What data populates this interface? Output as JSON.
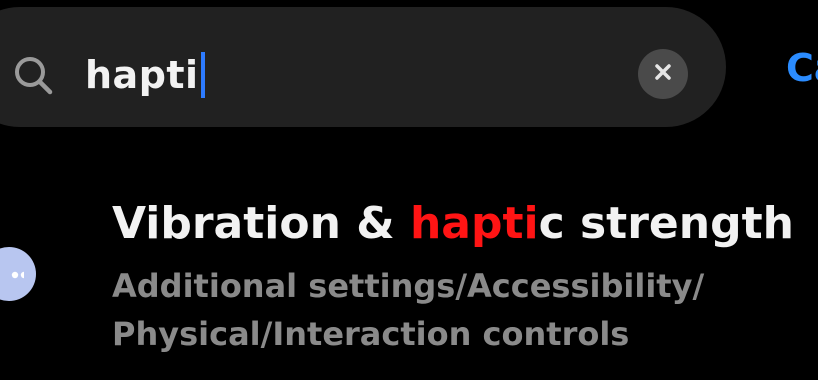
{
  "search": {
    "query": "hapti",
    "search_icon": "search-icon",
    "clear_icon": "close-icon",
    "cancel_label": "Ca"
  },
  "result": {
    "title_before": "Vibration & ",
    "title_match": "hapti",
    "title_after": "c strength",
    "path_line1": "Additional settings/Accessibility/",
    "path_line2": "Physical/Interaction controls"
  },
  "floating_ball": {
    "icon": "more-dots-icon"
  },
  "colors": {
    "background": "#000000",
    "search_bar": "#212121",
    "accent": "#2b8cff",
    "highlight": "#ff1414",
    "secondary_text": "#8a8a8a"
  }
}
